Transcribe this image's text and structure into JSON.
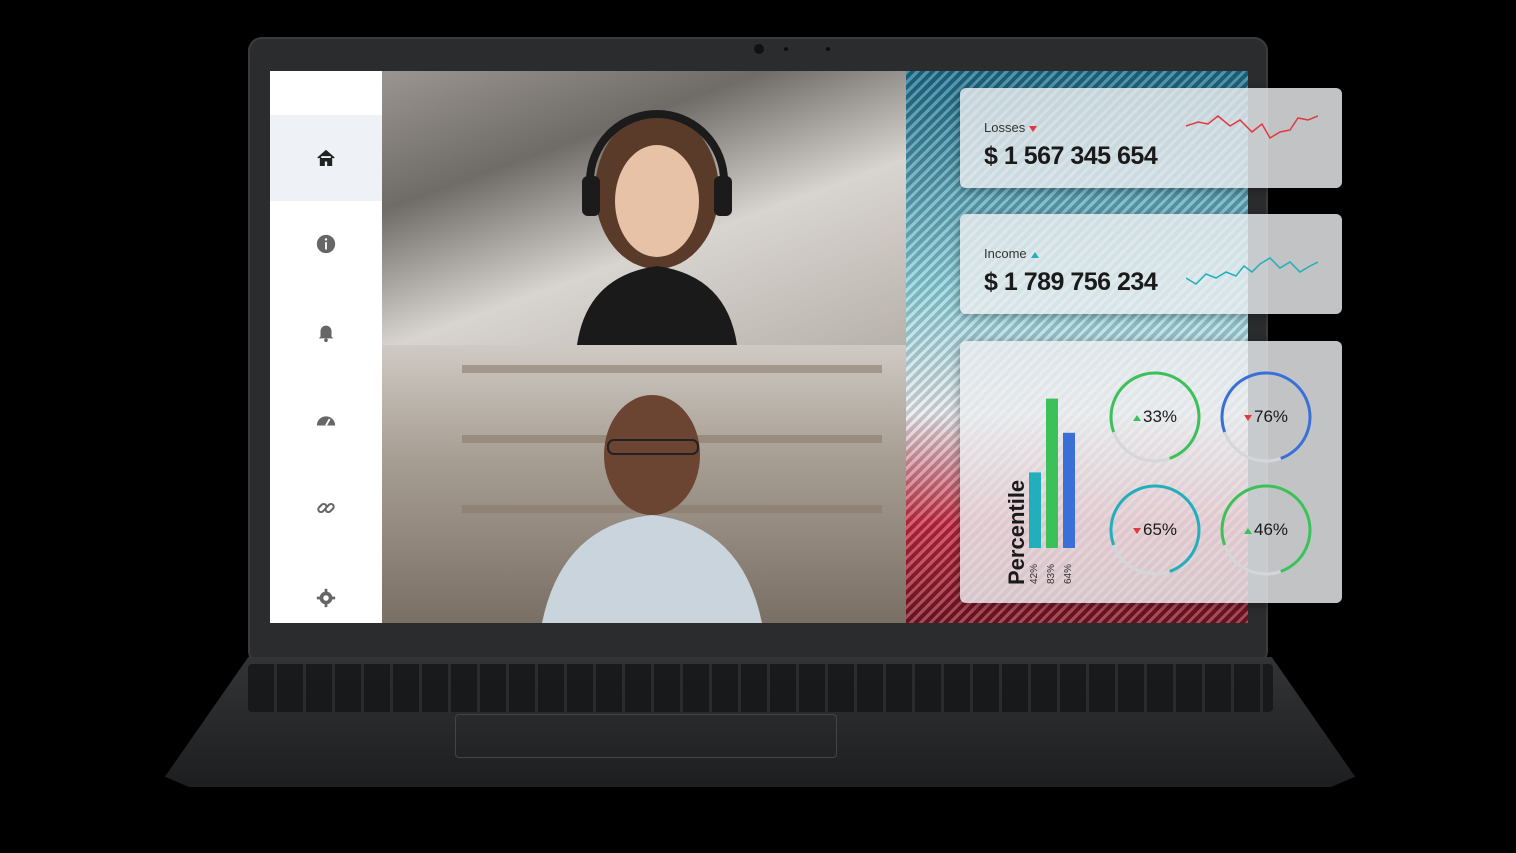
{
  "sidebar": {
    "items": [
      {
        "icon": "home-icon",
        "active": true
      },
      {
        "icon": "info-icon",
        "active": false
      },
      {
        "icon": "bell-icon",
        "active": false
      },
      {
        "icon": "speedometer-icon",
        "active": false
      },
      {
        "icon": "link-icon",
        "active": false
      },
      {
        "icon": "gear-icon",
        "active": false
      }
    ]
  },
  "cards": {
    "losses": {
      "label": "Losses",
      "value": "$ 1 567 345 654",
      "trend": "down",
      "color": "#e0393e"
    },
    "income": {
      "label": "Income",
      "value": "$ 1 789 756 234",
      "trend": "up",
      "color": "#22aebb"
    }
  },
  "percentile": {
    "title": "Percentile",
    "bars": [
      {
        "label": "42%",
        "value": 42,
        "color": "#22aebb"
      },
      {
        "label": "83%",
        "value": 83,
        "color": "#3cc15a"
      },
      {
        "label": "64%",
        "value": 64,
        "color": "#3a6fd8"
      }
    ],
    "gauges": [
      {
        "label": "33%",
        "value": 33,
        "trend": "up",
        "color": "#3cc15a"
      },
      {
        "label": "76%",
        "value": 76,
        "trend": "down",
        "color": "#3a6fd8"
      },
      {
        "label": "65%",
        "value": 65,
        "trend": "down",
        "color": "#22aebb"
      },
      {
        "label": "46%",
        "value": 46,
        "trend": "up",
        "color": "#3cc15a"
      }
    ]
  }
}
